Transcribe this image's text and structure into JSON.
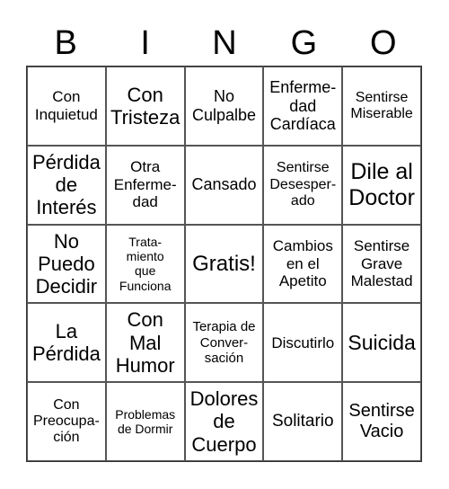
{
  "header": [
    "B",
    "I",
    "N",
    "G",
    "O"
  ],
  "cells": [
    "Con\nInquietud",
    "Con\nTristeza",
    "No\nCulpalbe",
    "Enferme-\ndad\nCardíaca",
    "Sentirse\nMiserable",
    "Pérdida\nde\nInterés",
    "Otra\nEnferme-\ndad",
    "Cansado",
    "Sentirse\nDesesper-\nado",
    "Dile al\nDoctor",
    "No\nPuedo\nDecidir",
    "Trata-\nmiento\nque\nFunciona",
    "Gratis!",
    "Cambios\nen el\nApetito",
    "Sentirse\nGrave\nMalestad",
    "La\nPérdida",
    "Con\nMal\nHumor",
    "Terapia de\nConver-\nsación",
    "Discutirlo",
    "Suicida",
    "Con\nPreocupa-\nción",
    "Problemas\nde Dormir",
    "Dolores\nde\nCuerpo",
    "Solitario",
    "Sentirse\nVacio"
  ]
}
